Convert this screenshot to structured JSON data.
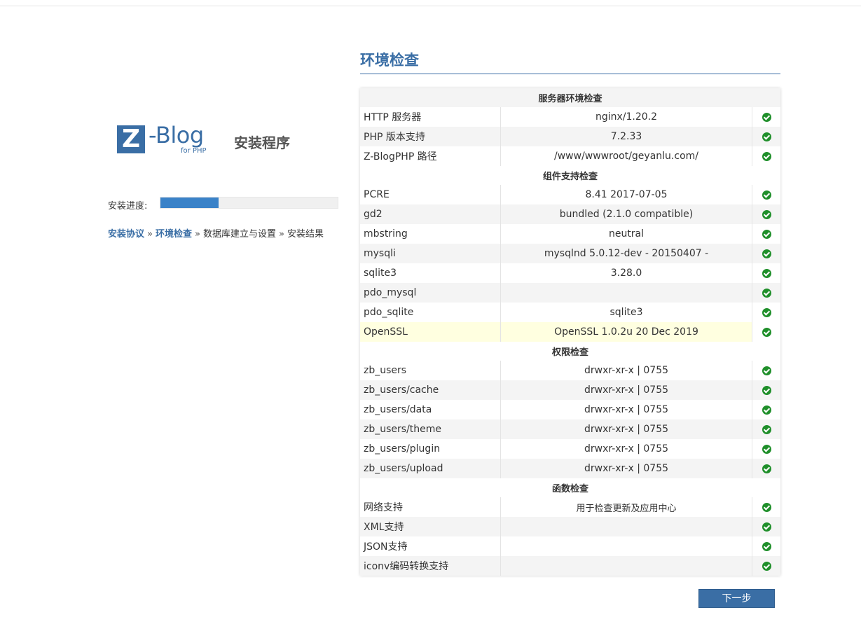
{
  "logo": {
    "letter": "Z",
    "word": "-Blog",
    "sub": "for PHP",
    "installer_title": "安装程序"
  },
  "progress": {
    "label": "安装进度:",
    "fraction": 0.33
  },
  "steps": [
    {
      "label": "安装协议",
      "state": "done"
    },
    {
      "label": "环境检查",
      "state": "done"
    },
    {
      "label": "数据库建立与设置",
      "state": "pending"
    },
    {
      "label": "安装结果",
      "state": "pending"
    }
  ],
  "step_separator": "»",
  "section": {
    "title": "环境检查"
  },
  "table": {
    "groups": [
      {
        "title": "服务器环境检查",
        "rows": [
          {
            "name": "HTTP 服务器",
            "value": "nginx/1.20.2",
            "ok": true
          },
          {
            "name": "PHP 版本支持",
            "value": "7.2.33",
            "ok": true
          },
          {
            "name": "Z-BlogPHP 路径",
            "value": "/www/wwwroot/geyanlu.com/",
            "ok": true
          }
        ]
      },
      {
        "title": "组件支持检查",
        "rows": [
          {
            "name": "PCRE",
            "value": "8.41 2017-07-05",
            "ok": true
          },
          {
            "name": "gd2",
            "value": "bundled (2.1.0 compatible)",
            "ok": true
          },
          {
            "name": "mbstring",
            "value": "neutral",
            "ok": true
          },
          {
            "name": "mysqli",
            "value": "mysqlnd 5.0.12-dev - 20150407 -",
            "ok": true
          },
          {
            "name": "sqlite3",
            "value": "3.28.0",
            "ok": true
          },
          {
            "name": "pdo_mysql",
            "value": "",
            "ok": true
          },
          {
            "name": "pdo_sqlite",
            "value": "sqlite3",
            "ok": true
          },
          {
            "name": "OpenSSL",
            "value": "OpenSSL 1.0.2u 20 Dec 2019",
            "ok": true,
            "highlight": true
          }
        ]
      },
      {
        "title": "权限检查",
        "rows": [
          {
            "name": "zb_users",
            "value": "drwxr-xr-x | 0755",
            "ok": true
          },
          {
            "name": "zb_users/cache",
            "value": "drwxr-xr-x | 0755",
            "ok": true
          },
          {
            "name": "zb_users/data",
            "value": "drwxr-xr-x | 0755",
            "ok": true
          },
          {
            "name": "zb_users/theme",
            "value": "drwxr-xr-x | 0755",
            "ok": true
          },
          {
            "name": "zb_users/plugin",
            "value": "drwxr-xr-x | 0755",
            "ok": true
          },
          {
            "name": "zb_users/upload",
            "value": "drwxr-xr-x | 0755",
            "ok": true
          }
        ]
      },
      {
        "title": "函数检查",
        "rows": [
          {
            "name": "网络支持",
            "value": "用于检查更新及应用中心",
            "ok": true,
            "small": true
          },
          {
            "name": "XML支持",
            "value": "",
            "ok": true
          },
          {
            "name": "JSON支持",
            "value": "",
            "ok": true
          },
          {
            "name": "iconv编码转换支持",
            "value": "",
            "ok": true
          }
        ]
      }
    ],
    "ok_icon": "check-circle-icon",
    "ok_color": "#1f8f2a"
  },
  "next_button": {
    "label": "下一步"
  },
  "colors": {
    "brand": "#3a6ea5",
    "progress_fill": "#3a82c8",
    "highlight_row": "#ffffe0"
  }
}
